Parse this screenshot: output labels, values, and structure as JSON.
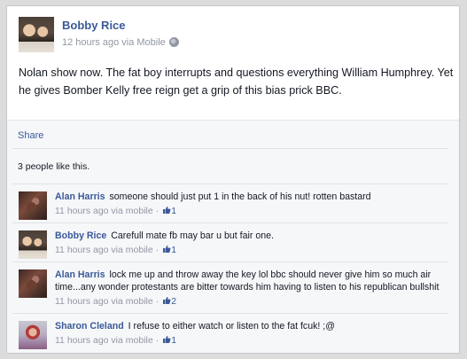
{
  "post": {
    "author": "Bobby Rice",
    "meta": "12 hours ago via Mobile",
    "privacy_icon": "globe-icon",
    "text": "Nolan show now. The fat boy interrupts and questions everything William Humphrey. Yet he gives Bomber Kelly free reign get a grip of this bias prick BBC."
  },
  "actions": {
    "share_label": "Share"
  },
  "likes": {
    "summary": "3 people like this."
  },
  "comments": [
    {
      "author": "Alan Harris",
      "text": "someone should just put 1 in the back of his nut! rotten bastard",
      "meta": "11 hours ago via mobile",
      "likes": "1"
    },
    {
      "author": "Bobby Rice",
      "text": "Carefull mate fb may bar u but fair one.",
      "meta": "11 hours ago via mobile",
      "likes": "1"
    },
    {
      "author": "Alan Harris",
      "text": "lock me up and throw away the key lol bbc should never give him so much air time...any wonder protestants are bitter towards him having to listen to his republican bullshit",
      "meta": "11 hours ago via mobile",
      "likes": "2"
    },
    {
      "author": "Sharon Cleland",
      "text": "I refuse to either watch or listen to the fat fcuk! ;@",
      "meta": "11 hours ago via mobile",
      "likes": "1"
    }
  ],
  "colors": {
    "link": "#3b5998",
    "meta": "#9197a3",
    "ufi_background": "#f6f7f9"
  }
}
